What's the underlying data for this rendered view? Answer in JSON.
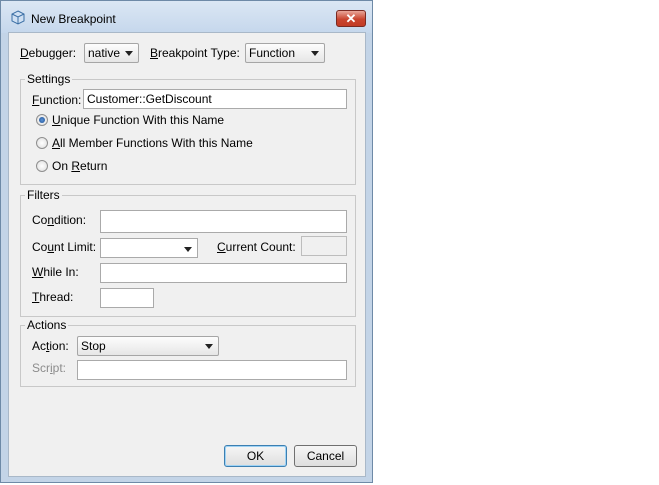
{
  "window": {
    "title": "New Breakpoint",
    "close_glyph": "✕"
  },
  "top": {
    "debugger_label_u": "D",
    "debugger_label_rest": "ebugger:",
    "debugger_value": "native",
    "bptype_label_u": "B",
    "bptype_label_rest": "reakpoint Type:",
    "bptype_value": "Function"
  },
  "settings": {
    "title": "Settings",
    "function_label_u": "F",
    "function_label_rest": "unction:",
    "function_value": "Customer::GetDiscount",
    "radios": [
      {
        "pre": "",
        "u": "U",
        "post": "nique Function With this Name",
        "checked": true
      },
      {
        "pre": "",
        "u": "A",
        "post": "ll Member Functions With this Name",
        "checked": false
      },
      {
        "pre": "On ",
        "u": "R",
        "post": "eturn",
        "checked": false
      }
    ]
  },
  "filters": {
    "title": "Filters",
    "condition_pre": "Co",
    "condition_u": "n",
    "condition_post": "dition:",
    "countlimit_pre": "Co",
    "countlimit_u": "u",
    "countlimit_post": "nt Limit:",
    "currentcount_u": "C",
    "currentcount_post": "urrent Count:",
    "whilein_u": "W",
    "whilein_post": "hile In:",
    "thread_u": "T",
    "thread_post": "hread:",
    "condition_value": "",
    "countlimit_value": "",
    "currentcount_value": "",
    "whilein_value": "",
    "thread_value": ""
  },
  "actions": {
    "title": "Actions",
    "action_pre": "Ac",
    "action_u": "t",
    "action_post": "ion:",
    "action_value": "Stop",
    "script_pre": "Scr",
    "script_u": "i",
    "script_post": "pt:",
    "script_value": ""
  },
  "buttons": {
    "ok": "OK",
    "cancel": "Cancel"
  }
}
